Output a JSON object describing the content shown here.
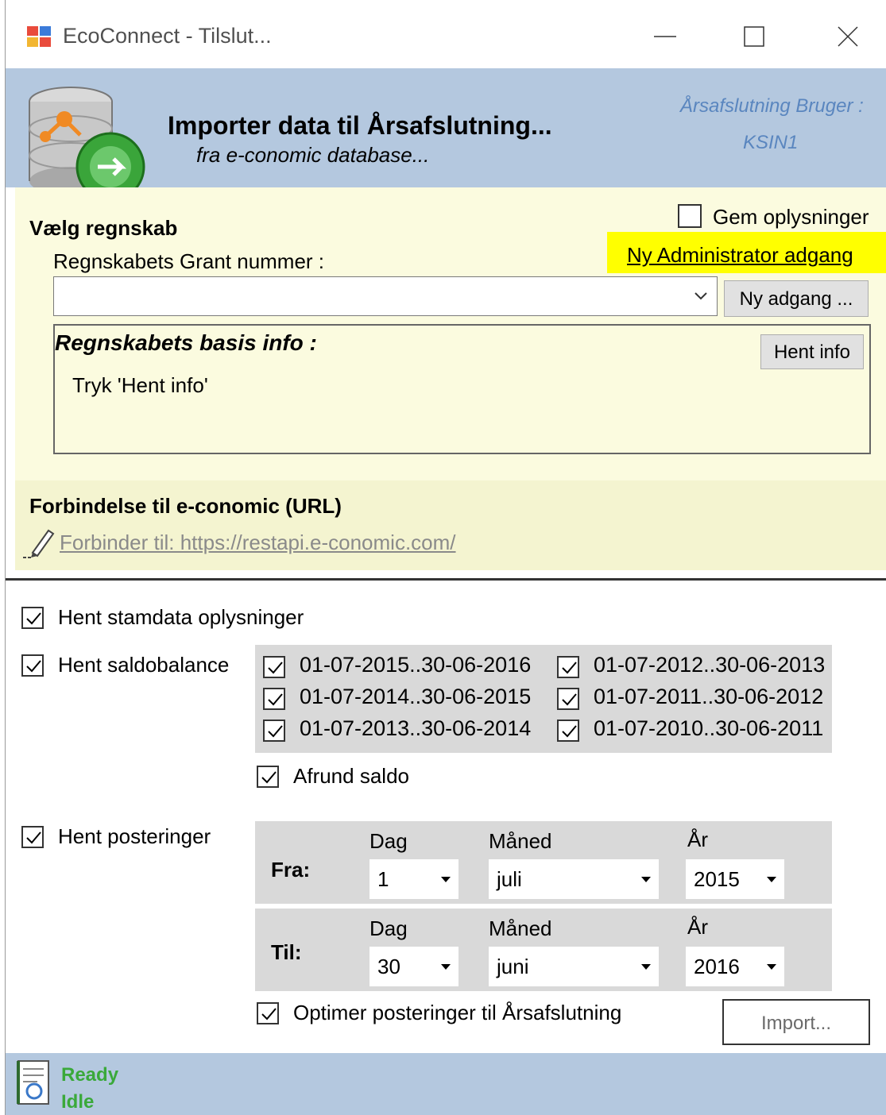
{
  "window": {
    "title": "EcoConnect - Tilslut..."
  },
  "header": {
    "title": "Importer data til Årsafslutning...",
    "subtitle": "fra e-conomic database...",
    "user_label": "Årsafslutning Bruger :",
    "user_value": "KSIN1"
  },
  "account": {
    "section_label": "Vælg regnskab",
    "remember_label": "Gem oplysninger",
    "remember_checked": false,
    "admin_link": "Ny Administrator adgang",
    "grant_label": "Regnskabets Grant nummer :",
    "grant_value": "",
    "new_access_button": "Ny adgang ...",
    "info_title": "Regnskabets basis info :",
    "info_button": "Hent info",
    "info_text": "Tryk 'Hent info'"
  },
  "connection": {
    "label": "Forbindelse til e-conomic (URL)",
    "link": "Forbinder til: https://restapi.e-conomic.com/"
  },
  "options": {
    "masterdata_label": "Hent stamdata oplysninger",
    "balance_label": "Hent saldobalance",
    "periods_left": [
      "01-07-2015..30-06-2016",
      "01-07-2014..30-06-2015",
      "01-07-2013..30-06-2014"
    ],
    "periods_right": [
      "01-07-2012..30-06-2013",
      "01-07-2011..30-06-2012",
      "01-07-2010..30-06-2011"
    ],
    "round_label": "Afrund saldo",
    "postings_label": "Hent posteringer",
    "optimize_label": "Optimer posteringer til Årsafslutning",
    "import_button": "Import..."
  },
  "range": {
    "day_header": "Dag",
    "month_header": "Måned",
    "year_header": "År",
    "from": {
      "label": "Fra:",
      "day": "1",
      "month": "juli",
      "year": "2015"
    },
    "to": {
      "label": "Til:",
      "day": "30",
      "month": "juni",
      "year": "2016"
    }
  },
  "status": {
    "line1": "Ready",
    "line2": "Idle"
  },
  "colors": {
    "header_bg": "#b4c8df",
    "panel_bg": "#fbfbdf",
    "highlight": "#ffff00",
    "status_green": "#3aa93a"
  }
}
